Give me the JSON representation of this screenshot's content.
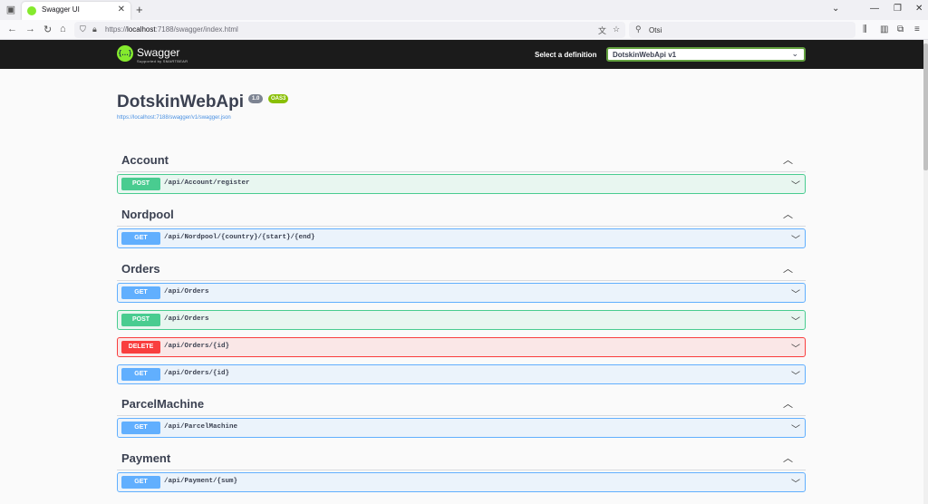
{
  "browser": {
    "tab_title": "Swagger UI",
    "tab_close": "✕",
    "new_tab": "+",
    "url_host": "localhost",
    "url_prefix": "https://",
    "url_rest": ":7188/swagger/index.html",
    "search_placeholder": "Otsi"
  },
  "topbar": {
    "logo_text": "Swagger",
    "logo_sub": "Supported by SMARTBEAR",
    "logo_glyph": "{…}",
    "definition_label": "Select a definition",
    "definition_value": "DotskinWebApi v1"
  },
  "info": {
    "title": "DotskinWebApi",
    "version": "1.0",
    "oas": "OAS3",
    "spec_url": "https://localhost:7188/swagger/v1/swagger.json"
  },
  "tags": [
    {
      "name": "Account",
      "operations": [
        {
          "method": "POST",
          "path": "/api/Account/register"
        }
      ]
    },
    {
      "name": "Nordpool",
      "operations": [
        {
          "method": "GET",
          "path": "/api/Nordpool/{country}/{start}/{end}"
        }
      ]
    },
    {
      "name": "Orders",
      "operations": [
        {
          "method": "GET",
          "path": "/api/Orders"
        },
        {
          "method": "POST",
          "path": "/api/Orders"
        },
        {
          "method": "DELETE",
          "path": "/api/Orders/{id}"
        },
        {
          "method": "GET",
          "path": "/api/Orders/{id}"
        }
      ]
    },
    {
      "name": "ParcelMachine",
      "operations": [
        {
          "method": "GET",
          "path": "/api/ParcelMachine"
        }
      ]
    },
    {
      "name": "Payment",
      "operations": [
        {
          "method": "GET",
          "path": "/api/Payment/{sum}"
        }
      ]
    }
  ],
  "colors": {
    "get": "#61affe",
    "post": "#49cc90",
    "delete": "#f93e3e",
    "topbar": "#1b1b1b"
  }
}
